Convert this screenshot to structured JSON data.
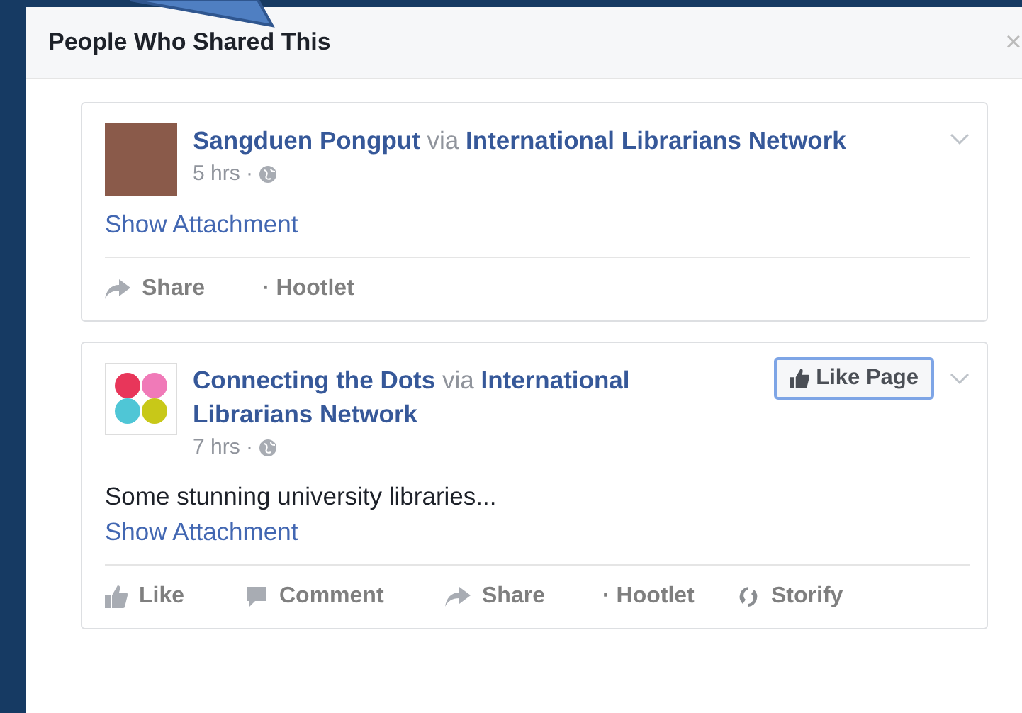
{
  "dialog": {
    "title": "People Who Shared This",
    "close": "×"
  },
  "posts": [
    {
      "kind": "photo",
      "author": "Sangduen Pongput",
      "via": "via",
      "page": "International Librarians Network",
      "time": "5 hrs ·",
      "attachment": "Show Attachment",
      "actions": [
        {
          "kind": "share",
          "label": "Share"
        },
        {
          "kind": "hootlet",
          "label": "· Hootlet"
        }
      ]
    },
    {
      "kind": "logo",
      "author": "Connecting the Dots",
      "via": "via",
      "page": "International Librarians Network",
      "time": "7 hrs ·",
      "like_page": "Like Page",
      "text": "Some stunning university libraries...",
      "attachment": "Show Attachment",
      "actions": [
        {
          "kind": "like",
          "label": "Like"
        },
        {
          "kind": "comment",
          "label": "Comment"
        },
        {
          "kind": "share",
          "label": "Share"
        },
        {
          "kind": "hootlet",
          "label": "· Hootlet"
        },
        {
          "kind": "storify",
          "label": "Storify"
        }
      ]
    }
  ]
}
